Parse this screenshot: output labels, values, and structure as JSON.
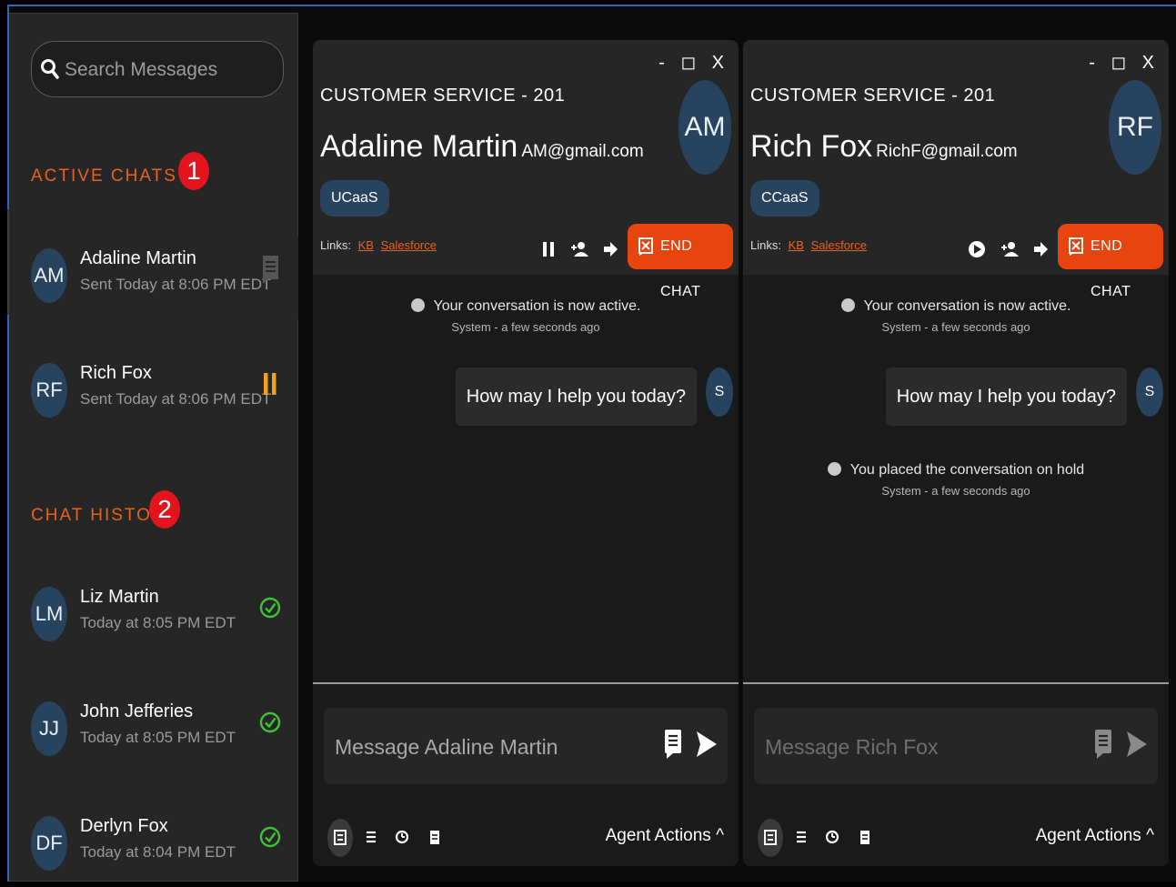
{
  "sidebar": {
    "search_placeholder": "Search Messages",
    "active_title": "ACTIVE CHATS (2)",
    "active_badge": "1",
    "history_title": "CHAT HISTORY",
    "history_badge": "2",
    "active_chats": [
      {
        "initials": "AM",
        "name": "Adaline Martin",
        "time": "Sent Today at 8:06 PM EDT",
        "status_icon": "chat-icon"
      },
      {
        "initials": "RF",
        "name": "Rich Fox",
        "time": "Sent Today at 8:06 PM EDT",
        "status_icon": "pause-icon"
      }
    ],
    "history": [
      {
        "initials": "LM",
        "name": "Liz Martin",
        "time": "Today at 8:05 PM EDT",
        "status_icon": "check-circle-icon"
      },
      {
        "initials": "JJ",
        "name": "John Jefferies",
        "time": "Today at 8:05 PM EDT",
        "status_icon": "check-circle-icon"
      },
      {
        "initials": "DF",
        "name": "Derlyn Fox",
        "time": "Today at 8:04 PM EDT",
        "status_icon": "check-circle-icon"
      }
    ]
  },
  "windows": [
    {
      "controls": "- ◻ X",
      "queue": "CUSTOMER SERVICE - 201",
      "customer_name": "Adaline Martin",
      "customer_email": "AM@gmail.com",
      "initials": "AM",
      "tag": "UCaaS",
      "links_label": "Links:",
      "links": [
        "KB",
        "Salesforce"
      ],
      "end_chat": "END CHAT",
      "hold_icon": "pause-icon",
      "messages": [
        {
          "type": "system",
          "text": "Your conversation is now active.",
          "meta": "System - a few seconds ago"
        },
        {
          "type": "agent",
          "text": "How may I help you today?",
          "sender": "S"
        }
      ],
      "composer_placeholder": "Message Adaline Martin",
      "agent_actions": "Agent Actions ^"
    },
    {
      "controls": "- ◻ X",
      "queue": "CUSTOMER SERVICE - 201",
      "customer_name": "Rich Fox",
      "customer_email": "RichF@gmail.com",
      "initials": "RF",
      "tag": "CCaaS",
      "links_label": "Links:",
      "links": [
        "KB",
        "Salesforce"
      ],
      "end_chat": "END CHAT",
      "hold_icon": "play-icon",
      "messages": [
        {
          "type": "system",
          "text": "Your conversation is now active.",
          "meta": "System - a few seconds ago"
        },
        {
          "type": "agent",
          "text": "How may I help you today?",
          "sender": "S"
        },
        {
          "type": "system",
          "text": "You placed the conversation on hold",
          "meta": "System - a few seconds ago"
        }
      ],
      "composer_placeholder": "Message Rich Fox",
      "agent_actions": "Agent Actions ^"
    }
  ],
  "colors": {
    "accent": "#e8621c",
    "end_chat": "#e8450e",
    "avatar": "#28435d",
    "badge": "#e3141c",
    "check": "#3fc23a",
    "pause": "#f0a21a"
  }
}
